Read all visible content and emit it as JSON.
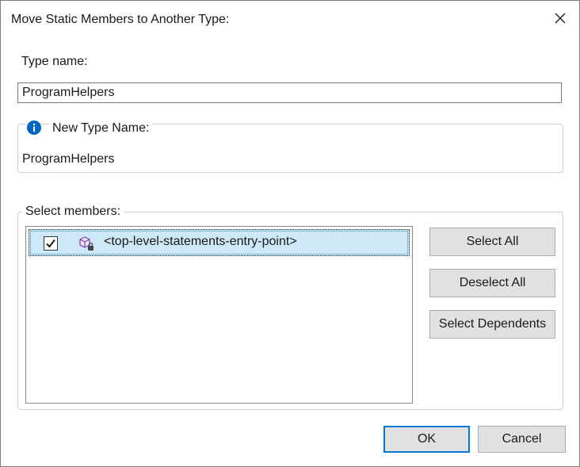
{
  "dialog": {
    "title": "Move Static Members to Another Type:"
  },
  "type_name": {
    "label": "Type name:",
    "value": "ProgramHelpers"
  },
  "new_type": {
    "legend": "New Type Name:",
    "value": "ProgramHelpers",
    "icon": "info-icon"
  },
  "members": {
    "legend": "Select members:",
    "items": [
      {
        "label": "<top-level-statements-entry-point>",
        "checked": true,
        "icon": "method-private-icon"
      }
    ]
  },
  "buttons": {
    "select_all": "Select All",
    "deselect_all": "Deselect All",
    "select_dependents": "Select Dependents",
    "ok": "OK",
    "cancel": "Cancel"
  },
  "colors": {
    "accent": "#0078d4",
    "selection": "#cde8f7",
    "info": "#0067c0"
  }
}
